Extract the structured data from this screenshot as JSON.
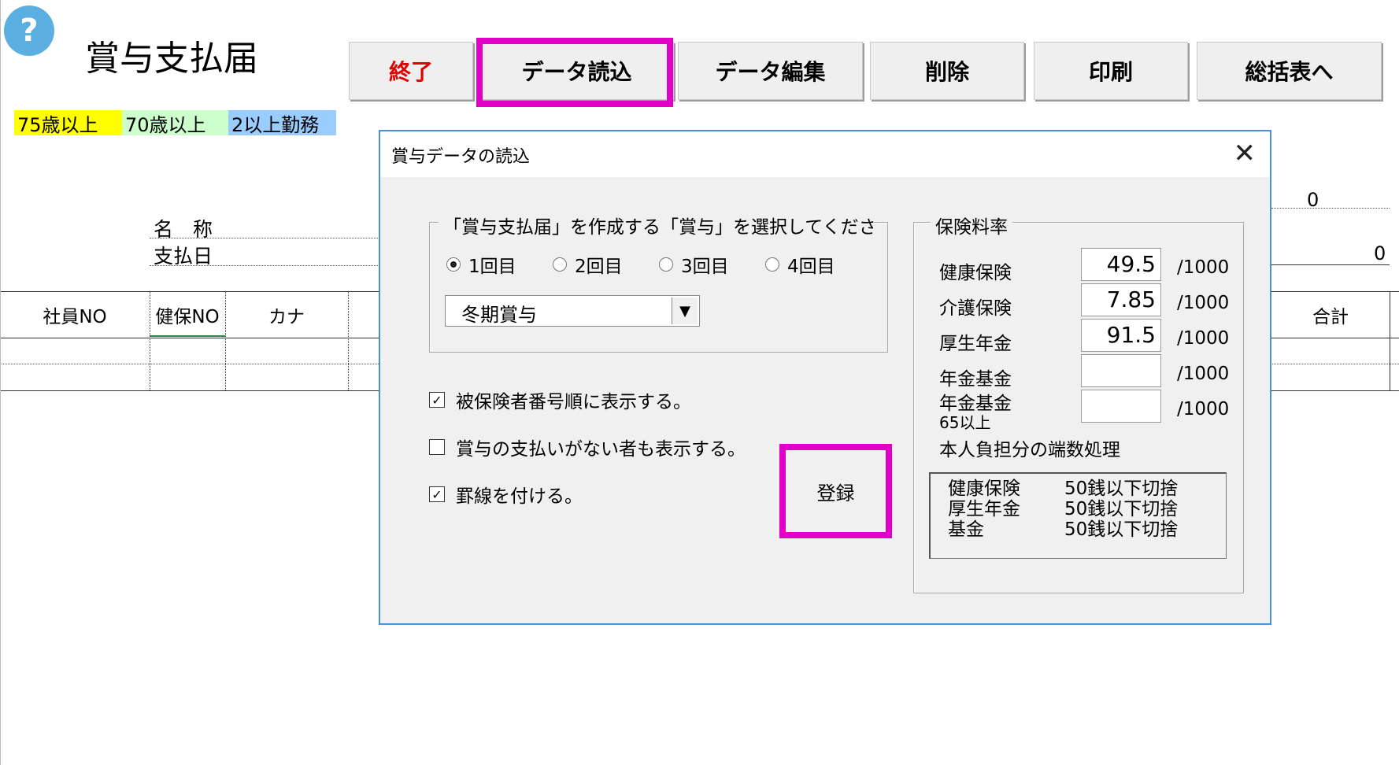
{
  "page": {
    "help_icon_glyph": "?",
    "title": "賞与支払届"
  },
  "toolbar": {
    "exit_label": "終了",
    "load_label": "データ読込",
    "edit_label": "データ編集",
    "delete_label": "削除",
    "print_label": "印刷",
    "summary_label": "総括表へ"
  },
  "legend": [
    {
      "label": "75歳以上",
      "color": "#ffff00"
    },
    {
      "label": "70歳以上",
      "color": "#ccffcc"
    },
    {
      "label": "2以上勤務",
      "color": "#99ccff"
    }
  ],
  "sheet": {
    "name_label": "名　称",
    "paydate_label": "支払日",
    "value_top": "0",
    "value_second": "0",
    "columns": [
      "社員NO",
      "健保NO",
      "カナ",
      "合計"
    ]
  },
  "dialog": {
    "title": "賞与データの読込",
    "close_glyph": "✕",
    "select_group_label": "「賞与支払届」を作成する「賞与」を選択してくださ",
    "radios": [
      {
        "label": "1回目",
        "checked": true
      },
      {
        "label": "2回目",
        "checked": false
      },
      {
        "label": "3回目",
        "checked": false
      },
      {
        "label": "4回目",
        "checked": false
      }
    ],
    "bonus_select_value": "冬期賞与",
    "options": [
      {
        "label": "被保険者番号順に表示する。",
        "checked": true
      },
      {
        "label": "賞与の支払いがない者も表示する。",
        "checked": false
      },
      {
        "label": "罫線を付ける。",
        "checked": true
      }
    ],
    "register_label": "登録",
    "rates_group_label": "保険料率",
    "rates": [
      {
        "label": "健康保険",
        "value": "49.5",
        "unit": "/1000"
      },
      {
        "label": "介護保険",
        "value": "7.85",
        "unit": "/1000"
      },
      {
        "label": "厚生年金",
        "value": "91.5",
        "unit": "/1000"
      },
      {
        "label": "年金基金",
        "value": "",
        "unit": "/1000"
      },
      {
        "label": "年金基金",
        "sublabel": "65以上",
        "value": "",
        "unit": "/1000"
      }
    ],
    "rounding_label": "本人負担分の端数処理",
    "rounding_rows": [
      {
        "label": "健康保険",
        "value": "50銭以下切捨"
      },
      {
        "label": "厚生年金",
        "value": "50銭以下切捨"
      },
      {
        "label": "基金",
        "value": "50銭以下切捨"
      }
    ],
    "highlight_color": "#e000c8"
  }
}
